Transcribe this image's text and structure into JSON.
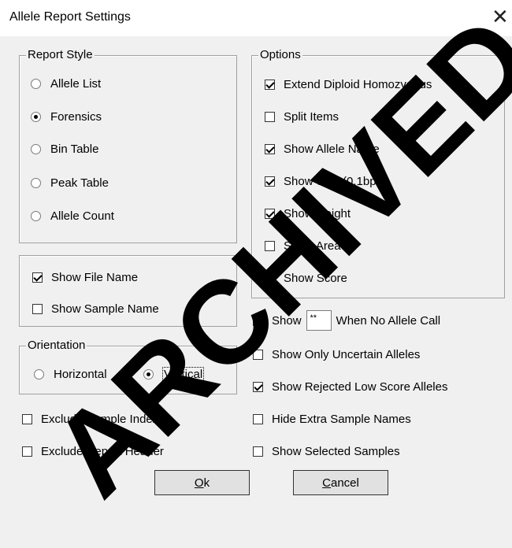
{
  "window": {
    "title": "Allele Report Settings",
    "close_glyph": "✕"
  },
  "report_style": {
    "legend": "Report Style",
    "options": [
      {
        "label": "Allele List",
        "selected": false
      },
      {
        "label": "Forensics",
        "selected": true
      },
      {
        "label": "Bin Table",
        "selected": false
      },
      {
        "label": "Peak Table",
        "selected": false
      },
      {
        "label": "Allele Count",
        "selected": false
      }
    ]
  },
  "file_group": {
    "show_file_name": {
      "label": "Show File Name",
      "checked": true
    },
    "show_sample_name": {
      "label": "Show Sample Name",
      "checked": false
    }
  },
  "orientation": {
    "legend": "Orientation",
    "horizontal": {
      "label": "Horizontal",
      "selected": false
    },
    "vertical": {
      "label": "Vertical",
      "selected": true
    }
  },
  "left_checks": [
    {
      "label": "Exclude Sample Index",
      "checked": false
    },
    {
      "label": "Exclude Report Header",
      "checked": false
    }
  ],
  "options": {
    "legend": "Options",
    "items": [
      {
        "label": "Extend Diploid Homozygous",
        "checked": true
      },
      {
        "label": "Split Items",
        "checked": false
      },
      {
        "label": "Show Allele Name",
        "checked": true
      },
      {
        "label": "Show Size (0.1bps)",
        "checked": true
      },
      {
        "label": "Show Height",
        "checked": true
      },
      {
        "label": "Show Area",
        "checked": false
      },
      {
        "label": "Show Score",
        "checked": false
      }
    ]
  },
  "no_call": {
    "prefix": "Show",
    "input_value": "**",
    "suffix": "When No Allele Call",
    "checked": false
  },
  "right_checks": [
    {
      "label": "Show Only Uncertain Alleles",
      "checked": false
    },
    {
      "label": "Show Rejected Low Score Alleles",
      "checked": true
    },
    {
      "label": "Hide Extra Sample Names",
      "checked": false
    },
    {
      "label": "Show Selected Samples",
      "checked": false
    }
  ],
  "buttons": {
    "ok": {
      "mnemonic": "O",
      "rest": "k"
    },
    "cancel": {
      "mnemonic": "C",
      "rest": "ancel"
    }
  },
  "watermark": "ARCHIVED"
}
